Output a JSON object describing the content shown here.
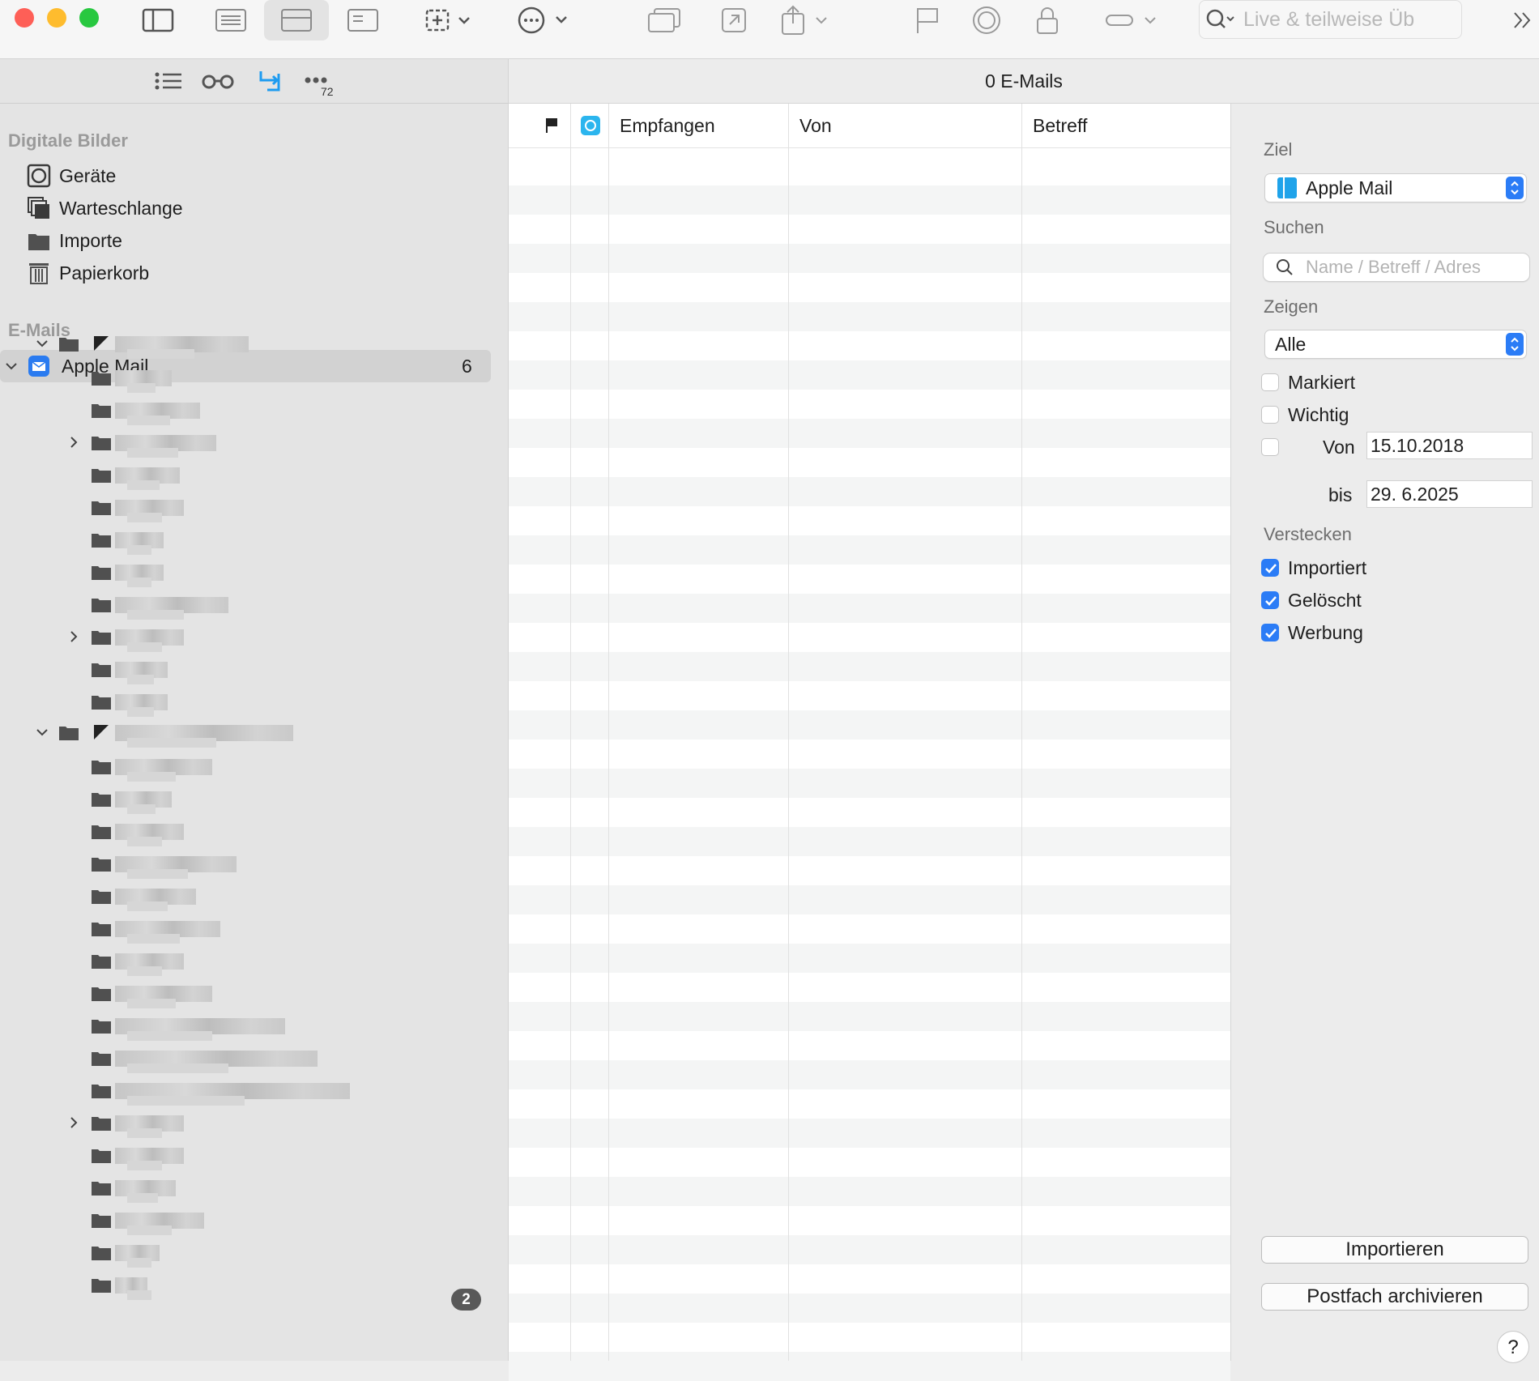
{
  "toolbar": {
    "search_placeholder": "Live & teilweise Üb"
  },
  "sidebar": {
    "section_images": "Digitale Bilder",
    "images_items": [
      {
        "label": "Geräte",
        "icon": "device-icon"
      },
      {
        "label": "Warteschlange",
        "icon": "queue-icon"
      },
      {
        "label": "Importe",
        "icon": "folder-icon"
      },
      {
        "label": "Papierkorb",
        "icon": "trash-icon"
      }
    ],
    "section_emails": "E-Mails",
    "mail_account": {
      "label": "Apple Mail",
      "count": "6"
    },
    "folder_badge": "2",
    "top_badge": "72"
  },
  "main": {
    "count_title": "0 E-Mails",
    "columns": {
      "received": "Empfangen",
      "from": "Von",
      "subject": "Betreff"
    }
  },
  "panel": {
    "target_label": "Ziel",
    "target_value": "Apple Mail",
    "search_label": "Suchen",
    "search_placeholder": "Name / Betreff / Adres",
    "show_label": "Zeigen",
    "show_value": "Alle",
    "flagged": "Markiert",
    "important": "Wichtig",
    "from_label": "Von",
    "from_date": "15.10.2018",
    "to_label": "bis",
    "to_date": "29.  6.2025",
    "hide_label": "Verstecken",
    "imported": "Importiert",
    "deleted": "Gelöscht",
    "ads": "Werbung",
    "import_button": "Importieren",
    "archive_button": "Postfach archivieren",
    "help": "?"
  },
  "colors": {
    "accent": "#2b7cf6",
    "close": "#fe5f57",
    "minimize": "#febc2e",
    "zoom": "#28c840"
  }
}
